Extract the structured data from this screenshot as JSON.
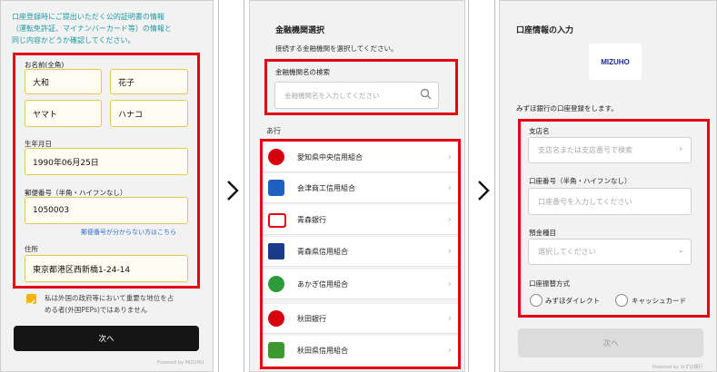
{
  "screen1": {
    "notice": [
      "口座登録時にご提出いただく公的証明書の情報",
      "（運転免許証、マイナンバーカード等）の情報と",
      "同じ内容かどうか確認してください。"
    ],
    "name_label": "お名前(全角)",
    "last_name": "大和",
    "first_name": "花子",
    "last_name_kana": "ヤマト",
    "first_name_kana": "ハナコ",
    "birthdate_label": "生年月日",
    "birthdate": "1990年06月25日",
    "postal_label": "郵便番号（半角・ハイフンなし）",
    "postal_code": "1050003",
    "postal_help_link": "郵便番号が分からない方はこちら",
    "address_label": "住所",
    "address": "東京都港区西新橋1-24-14",
    "peps_text": [
      "私は外国の政府等において重要な地位を占",
      "める者(外国PEPs)ではありません"
    ],
    "next_button": "次へ",
    "powered": "Powered by MIZUHO"
  },
  "screen2": {
    "title": "金融機関選択",
    "subtitle": "接続する金融機関を選択してください。",
    "search_label": "金融機関名の検索",
    "search_placeholder": "金融機関名を入力してください",
    "section_header": "あ行",
    "banks": [
      {
        "name": "愛知県中央信用組合",
        "color": "#d7000f"
      },
      {
        "name": "会津商工信用組合",
        "color": "#1f5fbf"
      },
      {
        "name": "青森銀行",
        "color": "#e60012"
      },
      {
        "name": "青森県信用組合",
        "color": "#1a3a8a"
      },
      {
        "name": "あかぎ信用組合",
        "color": "#2e9a3c"
      },
      {
        "name": "秋田銀行",
        "color": "#d7000f"
      },
      {
        "name": "秋田県信用組合",
        "color": "#3b9a2f"
      }
    ]
  },
  "screen3": {
    "title": "口座情報の入力",
    "logo_text": "MIZUHO",
    "intro": "みずほ銀行の口座登録をします。",
    "branch_label": "支店名",
    "branch_placeholder": "支店名または支店番号で検索",
    "account_label": "口座番号（半角・ハイフンなし）",
    "account_placeholder": "口座番号を入力してください",
    "type_label": "預金種目",
    "type_placeholder": "選択してください",
    "method_label": "口座振替方式",
    "method_options": [
      "みずほダイレクト",
      "キャッシュカード"
    ],
    "next_button": "次へ",
    "powered": "Powered by みずほ銀行"
  },
  "colors": {
    "highlight": "#e60012",
    "teal": "#1b9aa0",
    "field_border": "#e6c84a",
    "link": "#2f6fd0",
    "dark_button": "#151515"
  }
}
